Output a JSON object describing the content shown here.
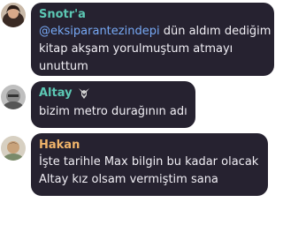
{
  "messages": [
    {
      "sender": "Snotr'a",
      "sender_color": "#5cc8b4",
      "avatar_icon": "user-avatar-photo",
      "mention": "@eksiparantezindepi",
      "lines": [
        "dün aldım dediğim",
        "kitap akşam yorulmuştum atmayı",
        "unuttum"
      ]
    },
    {
      "sender": "Altay",
      "sender_color": "#5cc8b4",
      "avatar_icon": "user-avatar-photo",
      "badge_icon": "transformers-autobot-icon",
      "lines": [
        "bizim metro durağının adı"
      ]
    },
    {
      "sender": "Hakan",
      "sender_color": "#f0b46a",
      "avatar_icon": "user-avatar-photo",
      "lines": [
        "İşte tarihle Max bilgin bu kadar olacak",
        "Altay kız olsam vermiştim sana"
      ]
    }
  ]
}
